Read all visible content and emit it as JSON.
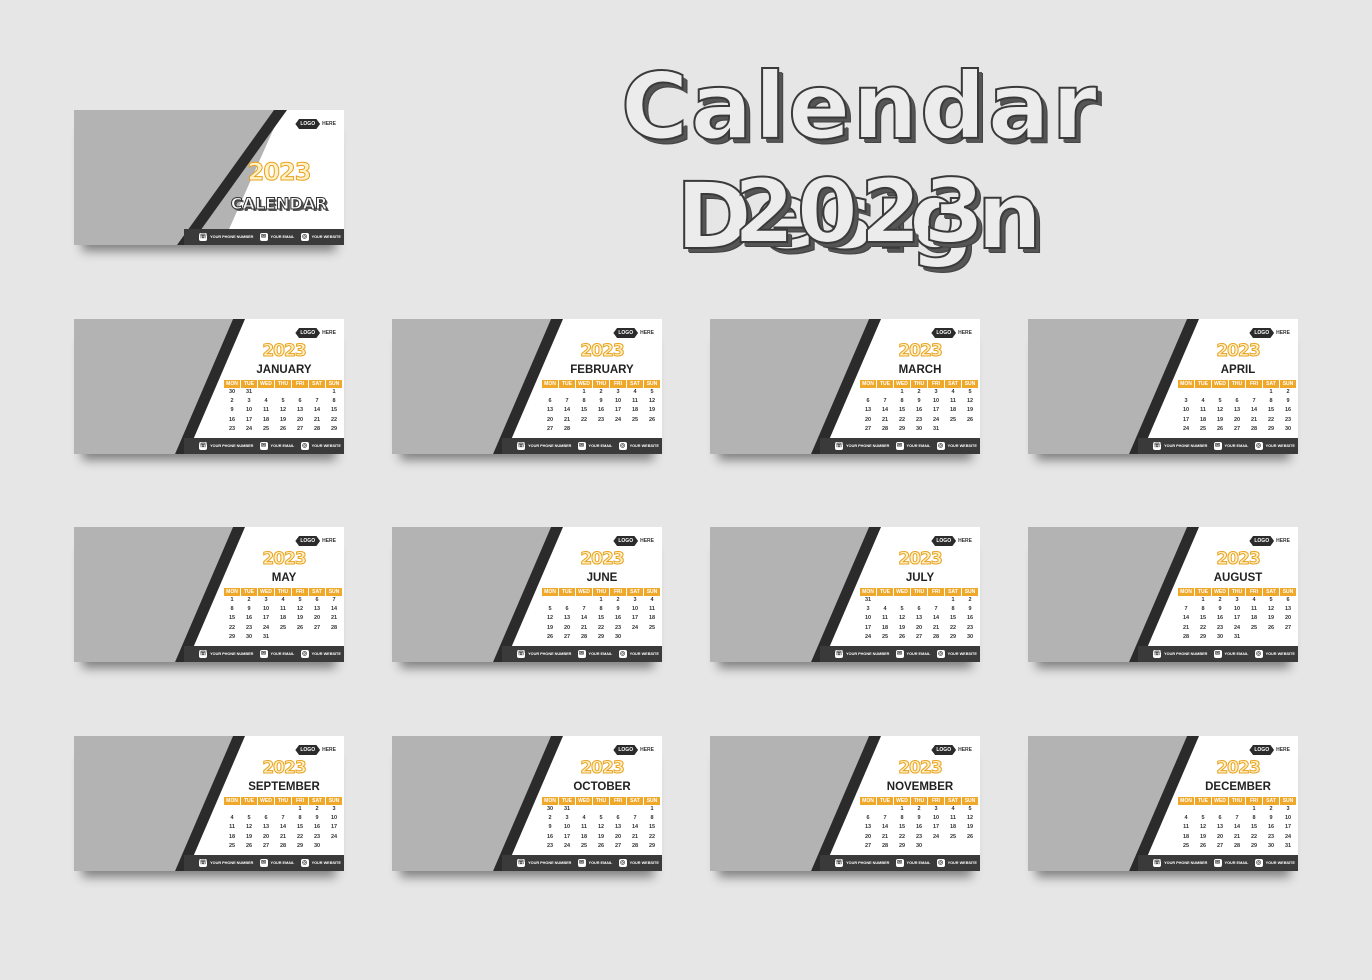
{
  "heading": {
    "line1": "Calendar Design",
    "line2": "2023"
  },
  "colors": {
    "accent": "#f0a82a",
    "dark": "#3a3a3a",
    "photo_placeholder": "#b3b3b3",
    "background": "#e6e6e6"
  },
  "cover": {
    "logo_badge": "LOGO",
    "logo_suffix": "HERE",
    "year": "2023",
    "title": "CALENDAR",
    "footer": {
      "phone": "YOUR PHONE NUMBER",
      "email": "YOUR EMAIL",
      "website": "YOUR WEBSITE"
    }
  },
  "common": {
    "logo_badge": "LOGO",
    "logo_suffix": "HERE",
    "year": "2023",
    "weekdays": [
      "MON",
      "TUE",
      "WED",
      "THU",
      "FRI",
      "SAT",
      "SUN"
    ],
    "footer": {
      "phone": "YOUR PHONE NUMBER",
      "email": "YOUR EMAIL",
      "website": "YOUR WEBSITE"
    }
  },
  "months": [
    {
      "name": "JANUARY",
      "weeks": [
        [
          "30",
          "31",
          "",
          "",
          "",
          "",
          "1"
        ],
        [
          "2",
          "3",
          "4",
          "5",
          "6",
          "7",
          "8"
        ],
        [
          "9",
          "10",
          "11",
          "12",
          "13",
          "14",
          "15"
        ],
        [
          "16",
          "17",
          "18",
          "19",
          "20",
          "21",
          "22"
        ],
        [
          "23",
          "24",
          "25",
          "26",
          "27",
          "28",
          "29"
        ]
      ]
    },
    {
      "name": "FEBRUARY",
      "weeks": [
        [
          "",
          "",
          "1",
          "2",
          "3",
          "4",
          "5"
        ],
        [
          "6",
          "7",
          "8",
          "9",
          "10",
          "11",
          "12"
        ],
        [
          "13",
          "14",
          "15",
          "16",
          "17",
          "18",
          "19"
        ],
        [
          "20",
          "21",
          "22",
          "23",
          "24",
          "25",
          "26"
        ],
        [
          "27",
          "28",
          "",
          "",
          "",
          "",
          ""
        ]
      ]
    },
    {
      "name": "MARCH",
      "weeks": [
        [
          "",
          "",
          "1",
          "2",
          "3",
          "4",
          "5"
        ],
        [
          "6",
          "7",
          "8",
          "9",
          "10",
          "11",
          "12"
        ],
        [
          "13",
          "14",
          "15",
          "16",
          "17",
          "18",
          "19"
        ],
        [
          "20",
          "21",
          "22",
          "23",
          "24",
          "25",
          "26"
        ],
        [
          "27",
          "28",
          "29",
          "30",
          "31",
          "",
          ""
        ]
      ]
    },
    {
      "name": "APRIL",
      "weeks": [
        [
          "",
          "",
          "",
          "",
          "",
          "1",
          "2"
        ],
        [
          "3",
          "4",
          "5",
          "6",
          "7",
          "8",
          "9"
        ],
        [
          "10",
          "11",
          "12",
          "13",
          "14",
          "15",
          "16"
        ],
        [
          "17",
          "18",
          "19",
          "20",
          "21",
          "22",
          "23"
        ],
        [
          "24",
          "25",
          "26",
          "27",
          "28",
          "29",
          "30"
        ]
      ]
    },
    {
      "name": "MAY",
      "weeks": [
        [
          "1",
          "2",
          "3",
          "4",
          "5",
          "6",
          "7"
        ],
        [
          "8",
          "9",
          "10",
          "11",
          "12",
          "13",
          "14"
        ],
        [
          "15",
          "16",
          "17",
          "18",
          "19",
          "20",
          "21"
        ],
        [
          "22",
          "23",
          "24",
          "25",
          "26",
          "27",
          "28"
        ],
        [
          "29",
          "30",
          "31",
          "",
          "",
          "",
          ""
        ]
      ]
    },
    {
      "name": "JUNE",
      "weeks": [
        [
          "",
          "",
          "",
          "1",
          "2",
          "3",
          "4"
        ],
        [
          "5",
          "6",
          "7",
          "8",
          "9",
          "10",
          "11"
        ],
        [
          "12",
          "13",
          "14",
          "15",
          "16",
          "17",
          "18"
        ],
        [
          "19",
          "20",
          "21",
          "22",
          "23",
          "24",
          "25"
        ],
        [
          "26",
          "27",
          "28",
          "29",
          "30",
          "",
          ""
        ]
      ]
    },
    {
      "name": "JULY",
      "weeks": [
        [
          "31",
          "",
          "",
          "",
          "",
          "1",
          "2"
        ],
        [
          "3",
          "4",
          "5",
          "6",
          "7",
          "8",
          "9"
        ],
        [
          "10",
          "11",
          "12",
          "13",
          "14",
          "15",
          "16"
        ],
        [
          "17",
          "18",
          "19",
          "20",
          "21",
          "22",
          "23"
        ],
        [
          "24",
          "25",
          "26",
          "27",
          "28",
          "29",
          "30"
        ]
      ]
    },
    {
      "name": "AUGUST",
      "weeks": [
        [
          "",
          "1",
          "2",
          "3",
          "4",
          "5",
          "6"
        ],
        [
          "7",
          "8",
          "9",
          "10",
          "11",
          "12",
          "13"
        ],
        [
          "14",
          "15",
          "16",
          "17",
          "18",
          "19",
          "20"
        ],
        [
          "21",
          "22",
          "23",
          "24",
          "25",
          "26",
          "27"
        ],
        [
          "28",
          "29",
          "30",
          "31",
          "",
          "",
          ""
        ]
      ]
    },
    {
      "name": "SEPTEMBER",
      "weeks": [
        [
          "",
          "",
          "",
          "",
          "1",
          "2",
          "3"
        ],
        [
          "4",
          "5",
          "6",
          "7",
          "8",
          "9",
          "10"
        ],
        [
          "11",
          "12",
          "13",
          "14",
          "15",
          "16",
          "17"
        ],
        [
          "18",
          "19",
          "20",
          "21",
          "22",
          "23",
          "24"
        ],
        [
          "25",
          "26",
          "27",
          "28",
          "29",
          "30",
          ""
        ]
      ]
    },
    {
      "name": "OCTOBER",
      "weeks": [
        [
          "30",
          "31",
          "",
          "",
          "",
          "",
          "1"
        ],
        [
          "2",
          "3",
          "4",
          "5",
          "6",
          "7",
          "8"
        ],
        [
          "9",
          "10",
          "11",
          "12",
          "13",
          "14",
          "15"
        ],
        [
          "16",
          "17",
          "18",
          "19",
          "20",
          "21",
          "22"
        ],
        [
          "23",
          "24",
          "25",
          "26",
          "27",
          "28",
          "29"
        ]
      ]
    },
    {
      "name": "NOVEMBER",
      "weeks": [
        [
          "",
          "",
          "1",
          "2",
          "3",
          "4",
          "5"
        ],
        [
          "6",
          "7",
          "8",
          "9",
          "10",
          "11",
          "12"
        ],
        [
          "13",
          "14",
          "15",
          "16",
          "17",
          "18",
          "19"
        ],
        [
          "20",
          "21",
          "22",
          "23",
          "24",
          "25",
          "26"
        ],
        [
          "27",
          "28",
          "29",
          "30",
          "",
          "",
          ""
        ]
      ]
    },
    {
      "name": "DECEMBER",
      "weeks": [
        [
          "",
          "",
          "",
          "",
          "1",
          "2",
          "3"
        ],
        [
          "4",
          "5",
          "6",
          "7",
          "8",
          "9",
          "10"
        ],
        [
          "11",
          "12",
          "13",
          "14",
          "15",
          "16",
          "17"
        ],
        [
          "18",
          "19",
          "20",
          "21",
          "22",
          "23",
          "24"
        ],
        [
          "25",
          "26",
          "27",
          "28",
          "29",
          "30",
          "31"
        ]
      ]
    }
  ]
}
